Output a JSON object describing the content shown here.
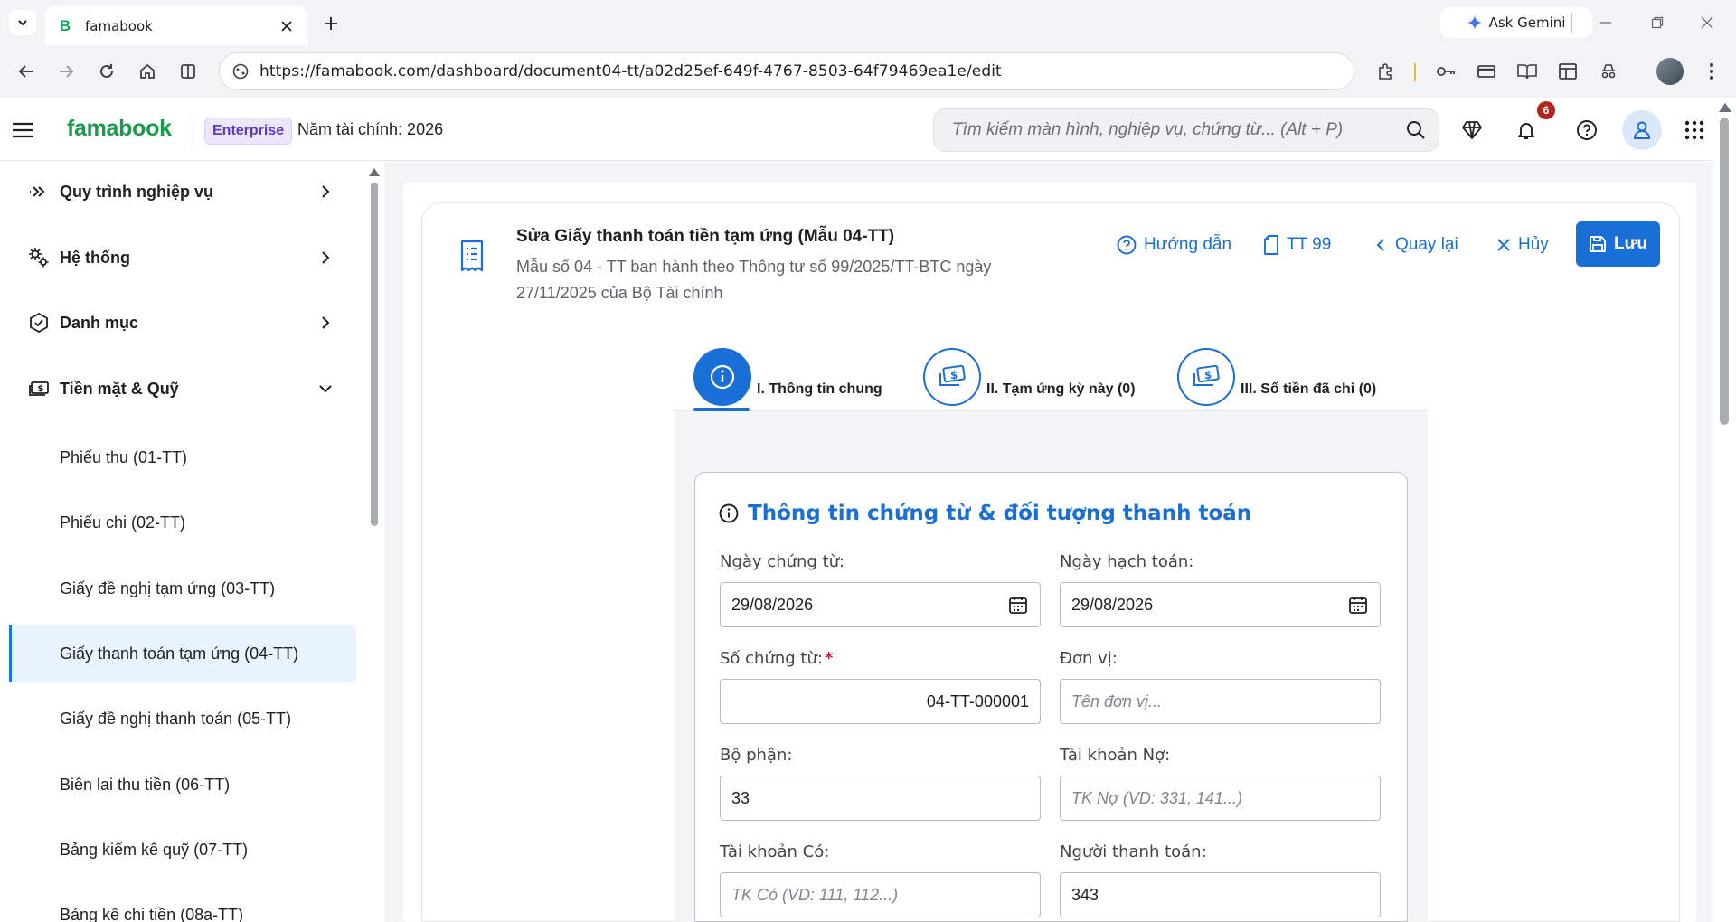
{
  "browser": {
    "tab_title": "famabook",
    "favicon_letter": "B",
    "gemini_label": "Ask Gemini",
    "url": "https://famabook.com/dashboard/document04-tt/a02d25ef-649f-4767-8503-64f79469ea1e/edit"
  },
  "header": {
    "brand": "famabook",
    "plan_badge": "Enterprise",
    "fiscal_year": "Năm tài chính: 2026",
    "search_placeholder": "Tìm kiếm màn hình, nghiệp vụ, chứng từ... (Alt + P)",
    "notification_count": "6"
  },
  "sidebar": {
    "groups": [
      {
        "label": "Quy trình nghiệp vụ",
        "icon": "chevrons-right-icon",
        "expanded": false
      },
      {
        "label": "Hệ thống",
        "icon": "gears-icon",
        "expanded": false
      },
      {
        "label": "Danh mục",
        "icon": "hexagon-tag-icon",
        "expanded": false
      },
      {
        "label": "Tiền mặt & Quỹ",
        "icon": "cash-icon",
        "expanded": true
      }
    ],
    "items": [
      {
        "label": "Phiếu thu (01-TT)",
        "active": false
      },
      {
        "label": "Phiếu chi (02-TT)",
        "active": false
      },
      {
        "label": "Giấy đề nghị tạm ứng (03-TT)",
        "active": false
      },
      {
        "label": "Giấy thanh toán tạm ứng (04-TT)",
        "active": true
      },
      {
        "label": "Giấy đề nghị thanh toán (05-TT)",
        "active": false
      },
      {
        "label": "Biên lai thu tiền (06-TT)",
        "active": false
      },
      {
        "label": "Bảng kiểm kê quỹ (07-TT)",
        "active": false
      },
      {
        "label": "Bảng kê chi tiền (08a-TT)",
        "active": false
      }
    ]
  },
  "document": {
    "title": "Sửa Giấy thanh toán tiền tạm ứng (Mẫu 04-TT)",
    "subtitle": "Mẫu số 04 - TT ban hành theo Thông tư số 99/2025/TT-BTC ngày 27/11/2025 của Bộ Tài chính",
    "actions": {
      "guide": "Hướng dẫn",
      "circular": "TT 99",
      "back": "Quay lại",
      "cancel": "Hủy",
      "save": "Lưu"
    }
  },
  "steps": [
    {
      "label": "I. Thông tin chung",
      "active": true
    },
    {
      "label": "II. Tạm ứng kỳ này (0)",
      "active": false
    },
    {
      "label": "III. Số tiền đã chi (0)",
      "active": false
    }
  ],
  "form": {
    "section_title": "Thông tin chứng từ & đối tượng thanh toán",
    "fields": {
      "doc_date": {
        "label": "Ngày chứng từ:",
        "value": "29/08/2026",
        "placeholder": ""
      },
      "post_date": {
        "label": "Ngày hạch toán:",
        "value": "29/08/2026",
        "placeholder": ""
      },
      "doc_no": {
        "label": "Số chứng từ:",
        "value": "04-TT-000001",
        "placeholder": "",
        "required_mark": "*"
      },
      "unit": {
        "label": "Đơn vị:",
        "value": "",
        "placeholder": "Tên đơn vị..."
      },
      "department": {
        "label": "Bộ phận:",
        "value": "33",
        "placeholder": ""
      },
      "debit_account": {
        "label": "Tài khoản Nợ:",
        "value": "",
        "placeholder": "TK Nợ (VD: 331, 141...)"
      },
      "credit_account": {
        "label": "Tài khoản Có:",
        "value": "",
        "placeholder": "TK Có (VD: 111, 112...)"
      },
      "payer": {
        "label": "Người thanh toán:",
        "value": "343",
        "placeholder": ""
      }
    }
  },
  "colors": {
    "brand_green": "#1a9a4b",
    "accent_blue": "#1a6fd6",
    "badge_red": "#b3261e"
  }
}
